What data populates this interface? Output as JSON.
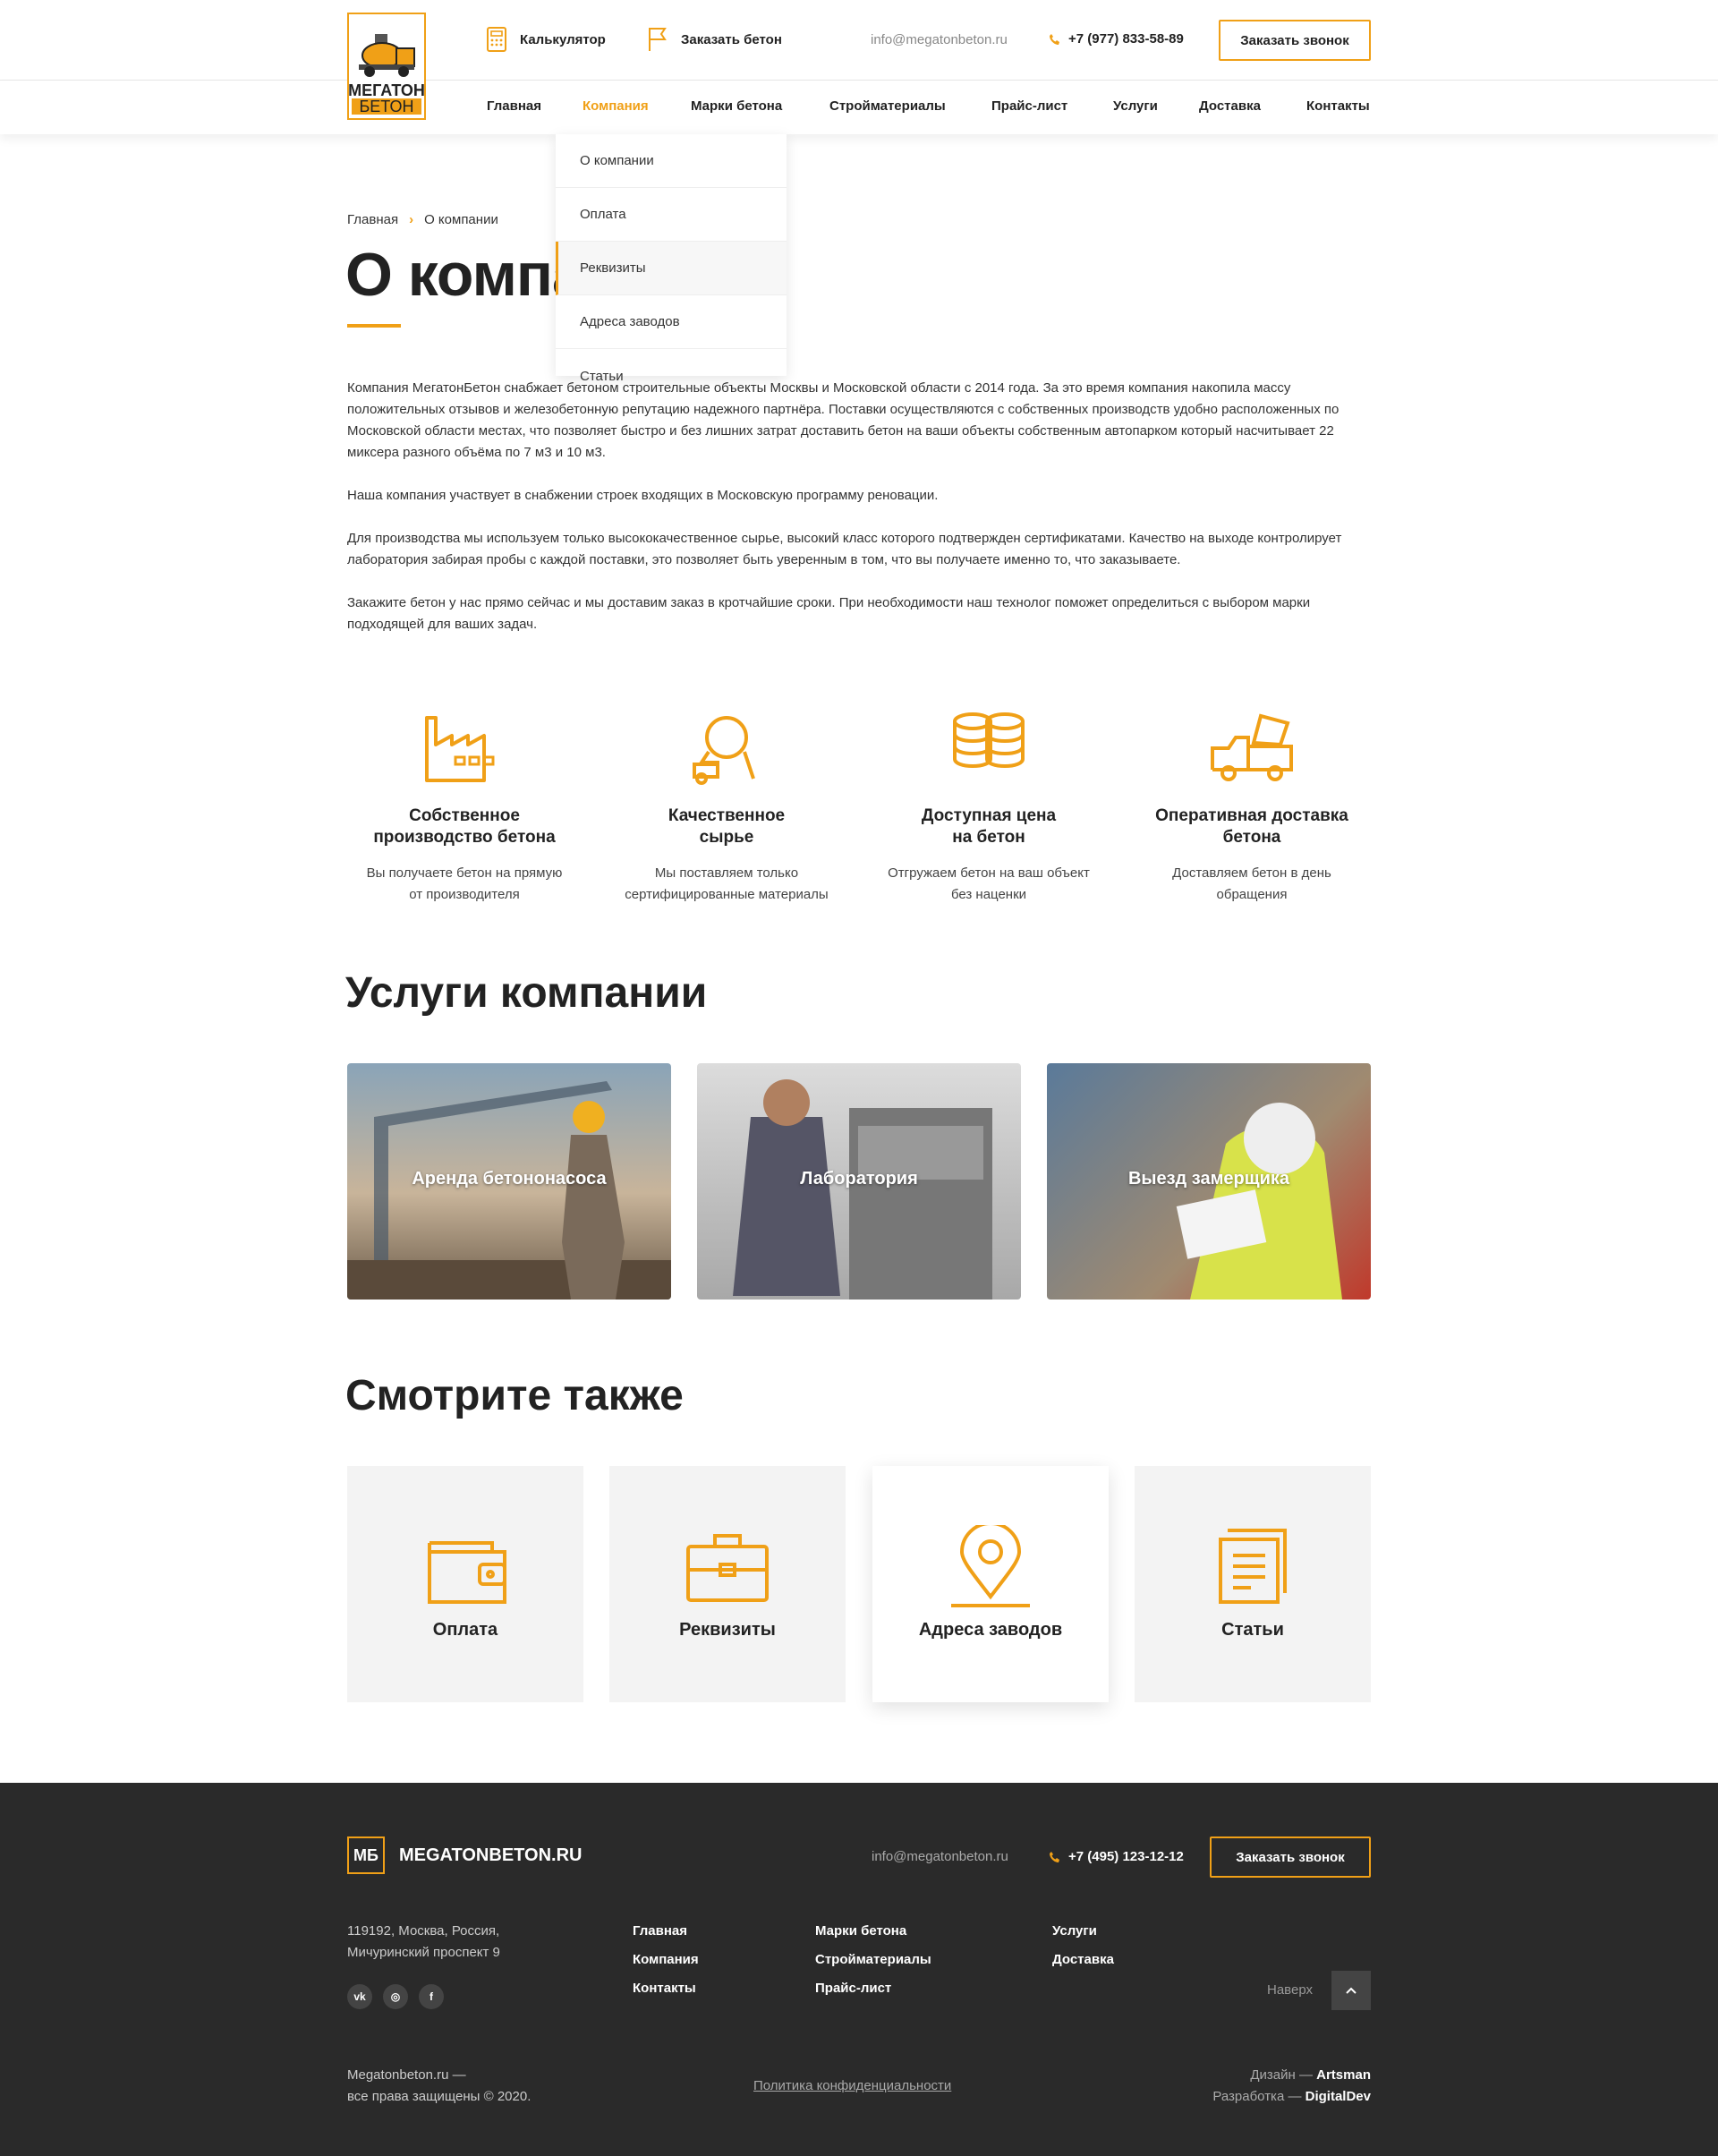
{
  "header": {
    "logo_line1": "МЕГАТОН",
    "logo_line2": "БЕТОН",
    "calculator": "Калькулятор",
    "order_concrete": "Заказать бетон",
    "email": "info@megatonbeton.ru",
    "phone": "+7 (977) 833-58-89",
    "callback": "Заказать звонок"
  },
  "nav": {
    "items": [
      "Главная",
      "Компания",
      "Марки бетона",
      "Стройматериалы",
      "Прайс-лист",
      "Услуги",
      "Доставка",
      "Контакты"
    ],
    "active": "Компания"
  },
  "dropdown": [
    "О компании",
    "Оплата",
    "Реквизиты",
    "Адреса заводов",
    "Статьи"
  ],
  "breadcrumb": {
    "home": "Главная",
    "current": "О компании"
  },
  "page_title": "О компании",
  "paragraphs": [
    "Компания МегатонБетон снабжает бетоном строительные объекты Москвы и Московской области с 2014 года. За это время компания накопила массу положительных отзывов и железобетонную репутацию надежного партнёра. Поставки осуществляются с собственных производств удобно расположенных по Московской области местах, что позволяет быстро и без лишних затрат доставить бетон на ваши объекты собственным автопарком который насчитывает 22 миксера разного объёма по 7 м3 и 10 м3.",
    "Наша компания участвует в снабжении строек входящих в Московскую программу реновации.",
    "Для производства мы используем только высококачественное сырье, высокий класс которого подтвержден сертификатами. Качество на выходе контролирует лаборатория забирая пробы с каждой поставки, это позволяет быть уверенным в том, что вы получаете именно то, что заказываете.",
    "Закажите бетон у нас прямо сейчас и мы доставим заказ в кротчайшие сроки. При необходимости наш технолог поможет определиться с выбором марки подходящей для ваших задач."
  ],
  "features": [
    {
      "icon": "factory-icon",
      "title1": "Собственное",
      "title2": "производство бетона",
      "desc1": "Вы получаете бетон на прямую",
      "desc2": "от производителя"
    },
    {
      "icon": "concrete-mixer-icon",
      "title1": "Качественное",
      "title2": "сырье",
      "desc1": "Мы поставляем только",
      "desc2": "сертифицированные материалы"
    },
    {
      "icon": "coins-icon",
      "title1": "Доступная цена",
      "title2": "на бетон",
      "desc1": "Отгружаем бетон на ваш объект",
      "desc2": "без наценки"
    },
    {
      "icon": "mixer-truck-icon",
      "title1": "Оперативная доставка",
      "title2": "бетона",
      "desc1": "Доставляем бетон в день",
      "desc2": "обращения"
    }
  ],
  "services_title": "Услуги компании",
  "services": [
    "Аренда бетононасоса",
    "Лаборатория",
    "Выезд замерщика"
  ],
  "see_also_title": "Смотрите также",
  "see_also": [
    {
      "icon": "wallet-icon",
      "label": "Оплата"
    },
    {
      "icon": "briefcase-icon",
      "label": "Реквизиты"
    },
    {
      "icon": "location-pin-icon",
      "label": "Адреса заводов"
    },
    {
      "icon": "documents-icon",
      "label": "Статьи"
    }
  ],
  "footer": {
    "logo_mark": "МБ",
    "logo_text": "MEGATONBETON.RU",
    "email": "info@megatonbeton.ru",
    "phone": "+7 (495) 123-12-12",
    "callback": "Заказать звонок",
    "address1": "119192, Москва, Россия,",
    "address2": "Мичуринский проспект 9",
    "col1": [
      "Главная",
      "Компания",
      "Контакты"
    ],
    "col2": [
      "Марки бетона",
      "Стройматериалы",
      "Прайс-лист"
    ],
    "col3": [
      "Услуги",
      "Доставка"
    ],
    "to_top": "Наверх",
    "copyright1": "Megatonbeton.ru —",
    "copyright2": "все права защищены © 2020.",
    "privacy": "Политика конфиденциальности",
    "design_label": "Дизайн — ",
    "design_by": "Artsman",
    "dev_label": "Разработка — ",
    "dev_by": "DigitalDev"
  },
  "colors": {
    "accent": "#f0a017",
    "footer_bg": "#2a2a2a"
  }
}
